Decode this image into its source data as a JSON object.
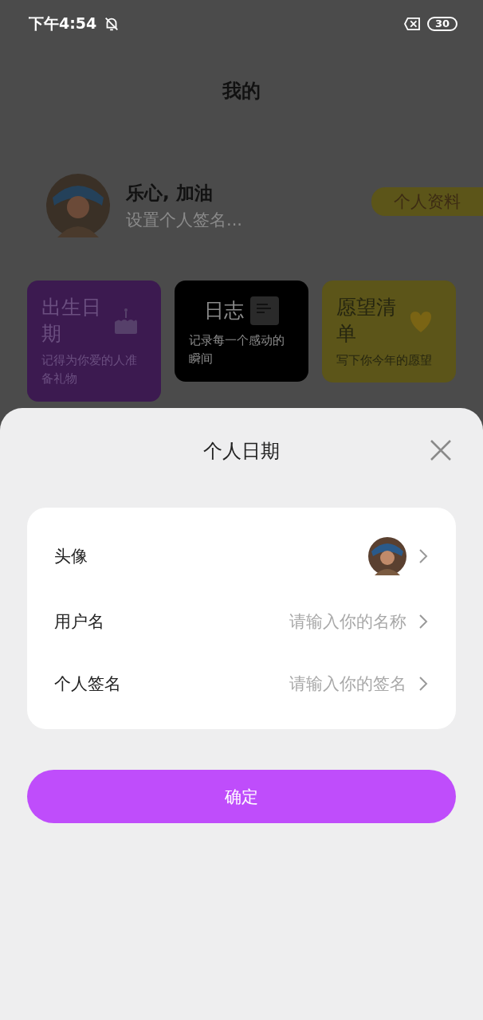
{
  "status_bar": {
    "time": "下午4:54",
    "battery": "30"
  },
  "header": {
    "title": "我的"
  },
  "profile": {
    "name": "乐心, 加油",
    "signature": "设置个人签名...",
    "button": "个人资料"
  },
  "cards": [
    {
      "kind": "cake",
      "title": "出生日期",
      "subtitle": "记得为你爱的人准备礼物",
      "color": "#3c1a50"
    },
    {
      "kind": "note",
      "title": "日志",
      "subtitle": "记录每一个感动的瞬间",
      "color": "#000000"
    },
    {
      "kind": "heart",
      "title": "愿望清单",
      "subtitle": "写下你今年的愿望",
      "color": "#5c5519"
    }
  ],
  "sheet": {
    "title": "个人日期",
    "rows": [
      {
        "kind": "avatar",
        "label": "头像"
      },
      {
        "kind": "input",
        "label": "用户名",
        "placeholder": "请输入你的名称"
      },
      {
        "kind": "input",
        "label": "个人签名",
        "placeholder": "请输入你的签名"
      }
    ],
    "confirm": "确定"
  }
}
